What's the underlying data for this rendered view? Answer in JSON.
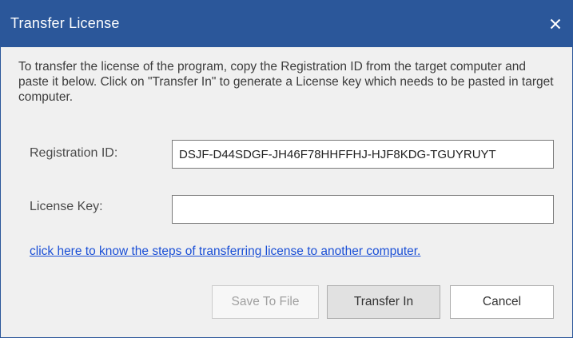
{
  "window": {
    "title": "Transfer License",
    "close_icon": "close-icon",
    "colors": {
      "titlebar": "#2b579a",
      "link": "#1a4fd6"
    }
  },
  "main": {
    "description": "To transfer the license of the program, copy the Registration ID from the target computer and paste it below. Click on \"Transfer In\" to generate a License key which needs to be pasted in target computer.",
    "registration_id": {
      "label": "Registration ID:",
      "value": "DSJF-D44SDGF-JH46F78HHFFHJ-HJF8KDG-TGUYRUYT"
    },
    "license_key": {
      "label": "License Key:",
      "value": ""
    },
    "help_link": "click here to know the steps of transferring license to another computer."
  },
  "buttons": {
    "save_to_file": "Save To File",
    "transfer_in": "Transfer In",
    "cancel": "Cancel"
  }
}
